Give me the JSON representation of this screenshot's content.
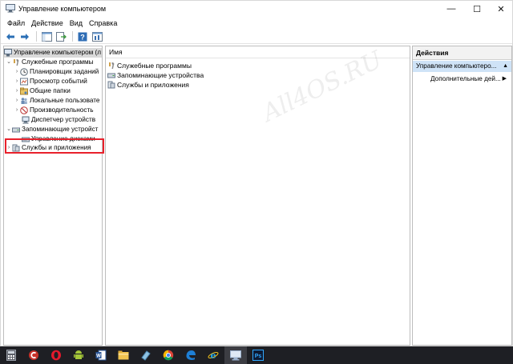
{
  "window": {
    "title": "Управление компьютером",
    "controls": {
      "minimize": "—",
      "maximize": "☐",
      "close": "✕"
    }
  },
  "menu": [
    "Файл",
    "Действие",
    "Вид",
    "Справка"
  ],
  "toolbar": {
    "icons": [
      "back-arrow-icon",
      "forward-arrow-icon",
      "console-tree-icon",
      "export-list-icon",
      "help-icon",
      "properties-icon"
    ]
  },
  "tree": {
    "root": "Управление компьютером (л",
    "system_tools": "Служебные программы",
    "task_scheduler": "Планировщик заданий",
    "event_viewer": "Просмотр событий",
    "shared_folders": "Общие папки",
    "local_users": "Локальные пользовате",
    "performance": "Производительность",
    "device_manager": "Диспетчер устройств",
    "storage": "Запоминающие устройст",
    "disk_management": "Управление дисками",
    "services_apps": "Службы и приложения"
  },
  "center": {
    "column_header": "Имя",
    "items": [
      "Служебные программы",
      "Запоминающие устройства",
      "Службы и приложения"
    ]
  },
  "actions": {
    "header": "Действия",
    "section": "Управление компьютеро...",
    "more_actions": "Дополнительные дей..."
  },
  "watermark": "All4OS.RU",
  "taskbar": {
    "icons": [
      "calculator-icon",
      "ccleaner-icon",
      "opera-icon",
      "android-icon",
      "word-icon",
      "file-explorer-icon",
      "notepad-icon",
      "chrome-icon",
      "edge-icon",
      "internet-explorer-icon",
      "computer-management-icon",
      "photoshop-icon"
    ]
  },
  "colors": {
    "highlight_border": "#e8212b",
    "actions_section_bg": "#cfe3f7",
    "taskbar_bg": "#1e1f24"
  }
}
